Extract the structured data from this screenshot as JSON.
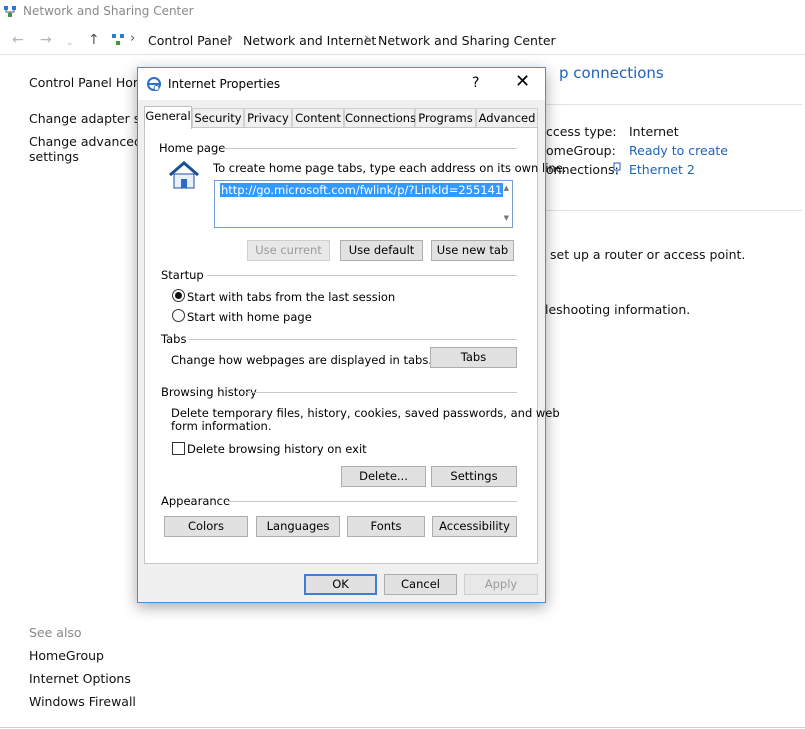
{
  "window": {
    "title": "Network and Sharing Center"
  },
  "address_bar": {
    "crumbs": [
      "Control Panel",
      "Network and Internet",
      "Network and Sharing Center"
    ]
  },
  "left_panel": {
    "home": "Control Panel Home",
    "links": [
      "Change adapter setti",
      "Change advanced sh",
      "settings"
    ],
    "see_also_label": "See also",
    "see_also": [
      "HomeGroup",
      "Internet Options",
      "Windows Firewall"
    ]
  },
  "main": {
    "heading_fragment": "p connections",
    "info": {
      "access_type_label": "ccess type:",
      "access_type_value": "Internet",
      "homegroup_label": "omeGroup:",
      "homegroup_value": "Ready to create",
      "connections_label": "onnections:",
      "connections_value": "Ethernet 2"
    },
    "router_text": "set up a router or access point.",
    "troubleshoot_text": "leshooting information."
  },
  "dialog": {
    "title": "Internet Properties",
    "help_glyph": "?",
    "close_glyph": "✕",
    "tabs": [
      "General",
      "Security",
      "Privacy",
      "Content",
      "Connections",
      "Programs",
      "Advanced"
    ],
    "active_tab": "General",
    "home_page": {
      "label": "Home page",
      "instructions": "To create home page tabs, type each address on its own line.",
      "url": "http://go.microsoft.com/fwlink/p/?LinkId=255141",
      "use_current": "Use current",
      "use_default": "Use default",
      "use_new_tab": "Use new tab"
    },
    "startup": {
      "label": "Startup",
      "option1": "Start with tabs from the last session",
      "option2": "Start with home page",
      "selected": "option1"
    },
    "tabs_section": {
      "label": "Tabs",
      "description": "Change how webpages are displayed in tabs.",
      "button": "Tabs"
    },
    "browsing_history": {
      "label": "Browsing history",
      "description_line1": "Delete temporary files, history, cookies, saved passwords, and web",
      "description_line2": "form information.",
      "delete_on_exit": "Delete browsing history on exit",
      "delete_on_exit_checked": false,
      "delete_button": "Delete...",
      "settings_button": "Settings"
    },
    "appearance": {
      "label": "Appearance",
      "colors": "Colors",
      "languages": "Languages",
      "fonts": "Fonts",
      "accessibility": "Accessibility"
    },
    "footer": {
      "ok": "OK",
      "cancel": "Cancel",
      "apply": "Apply"
    }
  }
}
